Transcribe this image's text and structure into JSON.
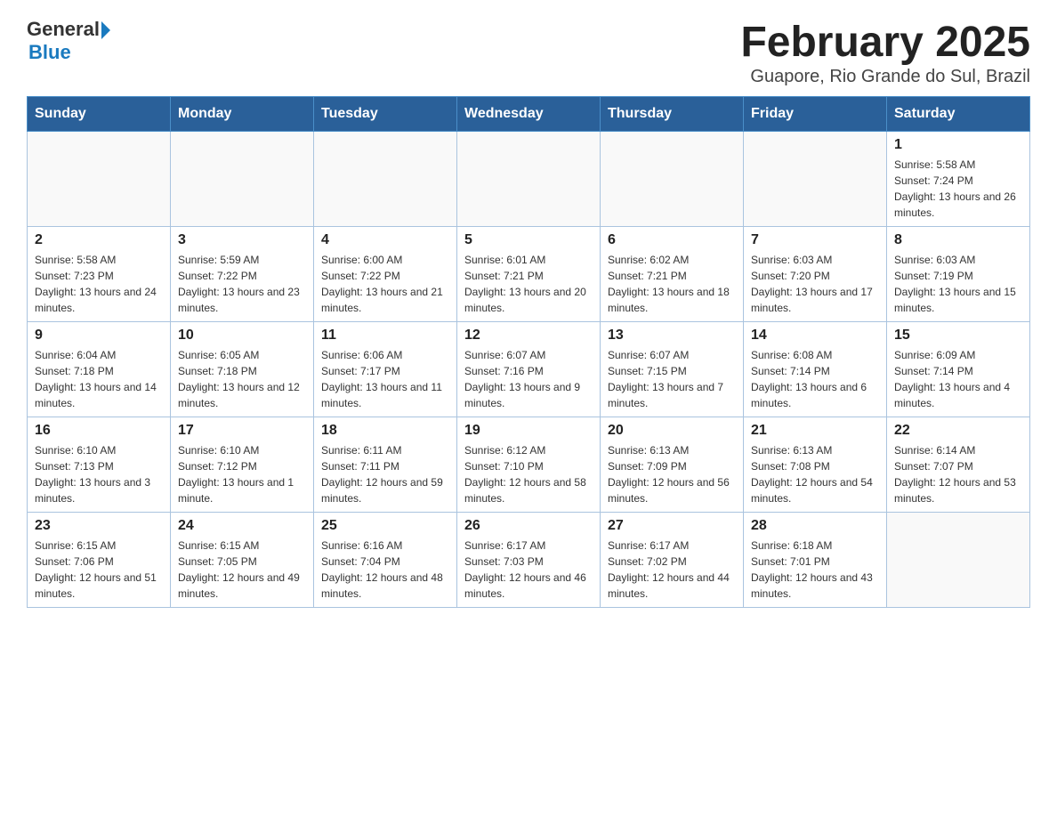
{
  "logo": {
    "general": "General",
    "blue": "Blue"
  },
  "title": "February 2025",
  "subtitle": "Guapore, Rio Grande do Sul, Brazil",
  "days_of_week": [
    "Sunday",
    "Monday",
    "Tuesday",
    "Wednesday",
    "Thursday",
    "Friday",
    "Saturday"
  ],
  "weeks": [
    [
      {
        "day": "",
        "info": ""
      },
      {
        "day": "",
        "info": ""
      },
      {
        "day": "",
        "info": ""
      },
      {
        "day": "",
        "info": ""
      },
      {
        "day": "",
        "info": ""
      },
      {
        "day": "",
        "info": ""
      },
      {
        "day": "1",
        "info": "Sunrise: 5:58 AM\nSunset: 7:24 PM\nDaylight: 13 hours and 26 minutes."
      }
    ],
    [
      {
        "day": "2",
        "info": "Sunrise: 5:58 AM\nSunset: 7:23 PM\nDaylight: 13 hours and 24 minutes."
      },
      {
        "day": "3",
        "info": "Sunrise: 5:59 AM\nSunset: 7:22 PM\nDaylight: 13 hours and 23 minutes."
      },
      {
        "day": "4",
        "info": "Sunrise: 6:00 AM\nSunset: 7:22 PM\nDaylight: 13 hours and 21 minutes."
      },
      {
        "day": "5",
        "info": "Sunrise: 6:01 AM\nSunset: 7:21 PM\nDaylight: 13 hours and 20 minutes."
      },
      {
        "day": "6",
        "info": "Sunrise: 6:02 AM\nSunset: 7:21 PM\nDaylight: 13 hours and 18 minutes."
      },
      {
        "day": "7",
        "info": "Sunrise: 6:03 AM\nSunset: 7:20 PM\nDaylight: 13 hours and 17 minutes."
      },
      {
        "day": "8",
        "info": "Sunrise: 6:03 AM\nSunset: 7:19 PM\nDaylight: 13 hours and 15 minutes."
      }
    ],
    [
      {
        "day": "9",
        "info": "Sunrise: 6:04 AM\nSunset: 7:18 PM\nDaylight: 13 hours and 14 minutes."
      },
      {
        "day": "10",
        "info": "Sunrise: 6:05 AM\nSunset: 7:18 PM\nDaylight: 13 hours and 12 minutes."
      },
      {
        "day": "11",
        "info": "Sunrise: 6:06 AM\nSunset: 7:17 PM\nDaylight: 13 hours and 11 minutes."
      },
      {
        "day": "12",
        "info": "Sunrise: 6:07 AM\nSunset: 7:16 PM\nDaylight: 13 hours and 9 minutes."
      },
      {
        "day": "13",
        "info": "Sunrise: 6:07 AM\nSunset: 7:15 PM\nDaylight: 13 hours and 7 minutes."
      },
      {
        "day": "14",
        "info": "Sunrise: 6:08 AM\nSunset: 7:14 PM\nDaylight: 13 hours and 6 minutes."
      },
      {
        "day": "15",
        "info": "Sunrise: 6:09 AM\nSunset: 7:14 PM\nDaylight: 13 hours and 4 minutes."
      }
    ],
    [
      {
        "day": "16",
        "info": "Sunrise: 6:10 AM\nSunset: 7:13 PM\nDaylight: 13 hours and 3 minutes."
      },
      {
        "day": "17",
        "info": "Sunrise: 6:10 AM\nSunset: 7:12 PM\nDaylight: 13 hours and 1 minute."
      },
      {
        "day": "18",
        "info": "Sunrise: 6:11 AM\nSunset: 7:11 PM\nDaylight: 12 hours and 59 minutes."
      },
      {
        "day": "19",
        "info": "Sunrise: 6:12 AM\nSunset: 7:10 PM\nDaylight: 12 hours and 58 minutes."
      },
      {
        "day": "20",
        "info": "Sunrise: 6:13 AM\nSunset: 7:09 PM\nDaylight: 12 hours and 56 minutes."
      },
      {
        "day": "21",
        "info": "Sunrise: 6:13 AM\nSunset: 7:08 PM\nDaylight: 12 hours and 54 minutes."
      },
      {
        "day": "22",
        "info": "Sunrise: 6:14 AM\nSunset: 7:07 PM\nDaylight: 12 hours and 53 minutes."
      }
    ],
    [
      {
        "day": "23",
        "info": "Sunrise: 6:15 AM\nSunset: 7:06 PM\nDaylight: 12 hours and 51 minutes."
      },
      {
        "day": "24",
        "info": "Sunrise: 6:15 AM\nSunset: 7:05 PM\nDaylight: 12 hours and 49 minutes."
      },
      {
        "day": "25",
        "info": "Sunrise: 6:16 AM\nSunset: 7:04 PM\nDaylight: 12 hours and 48 minutes."
      },
      {
        "day": "26",
        "info": "Sunrise: 6:17 AM\nSunset: 7:03 PM\nDaylight: 12 hours and 46 minutes."
      },
      {
        "day": "27",
        "info": "Sunrise: 6:17 AM\nSunset: 7:02 PM\nDaylight: 12 hours and 44 minutes."
      },
      {
        "day": "28",
        "info": "Sunrise: 6:18 AM\nSunset: 7:01 PM\nDaylight: 12 hours and 43 minutes."
      },
      {
        "day": "",
        "info": ""
      }
    ]
  ]
}
